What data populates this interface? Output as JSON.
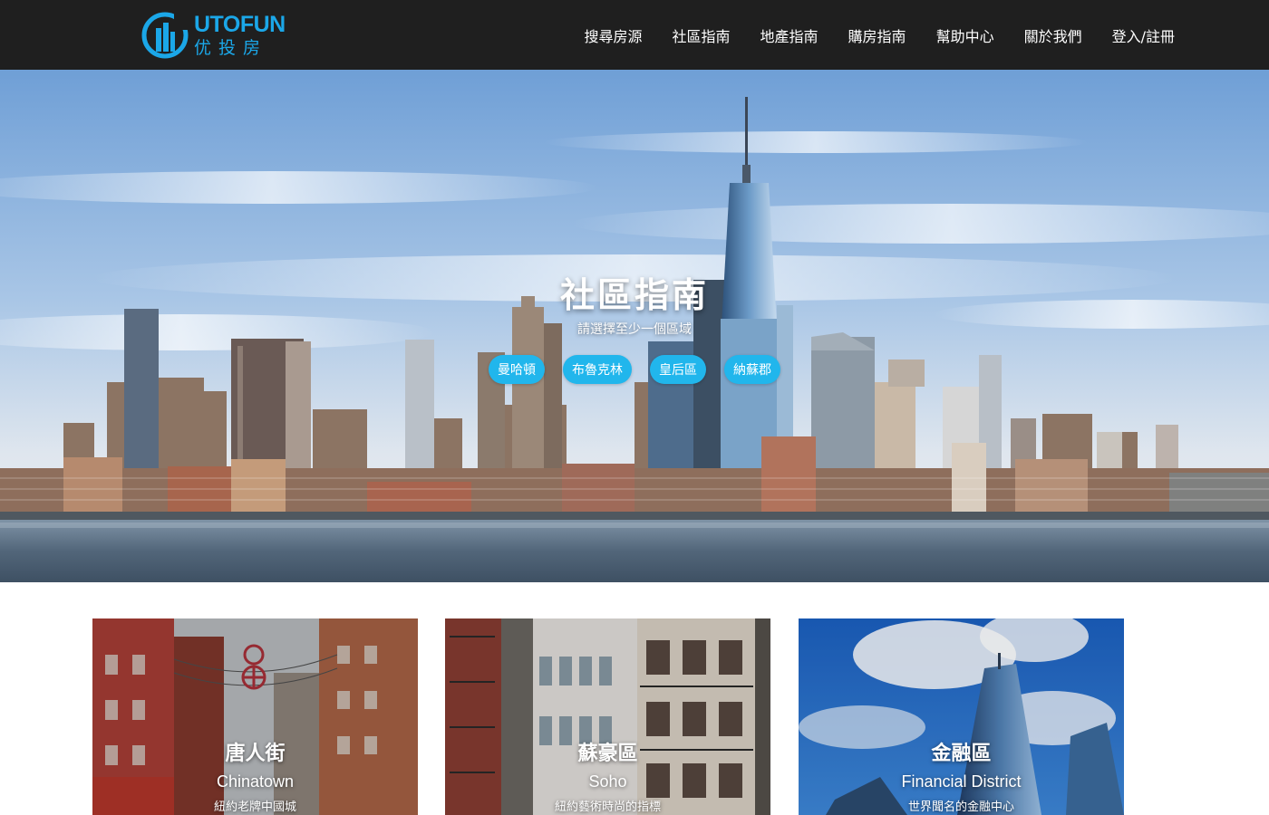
{
  "header": {
    "logo_en": "UTOFUN",
    "logo_cn": "优投房",
    "nav": [
      {
        "label": "搜尋房源"
      },
      {
        "label": "社區指南"
      },
      {
        "label": "地產指南"
      },
      {
        "label": "購房指南"
      },
      {
        "label": "幫助中心"
      },
      {
        "label": "關於我們"
      },
      {
        "label": "登入/註冊"
      }
    ]
  },
  "hero": {
    "title": "社區指南",
    "subtitle": "請選擇至少一個區域",
    "boroughs": [
      {
        "label": "曼哈頓"
      },
      {
        "label": "布魯克林"
      },
      {
        "label": "皇后區"
      },
      {
        "label": "納蘇郡"
      }
    ]
  },
  "neighborhoods": [
    {
      "title": "唐人街",
      "english": "Chinatown",
      "description": "紐約老牌中國城"
    },
    {
      "title": "蘇豪區",
      "english": "Soho",
      "description": "紐約藝術時尚的指標"
    },
    {
      "title": "金融區",
      "english": "Financial District",
      "description": "世界聞名的金融中心"
    }
  ],
  "colors": {
    "header_bg": "#1f1f1f",
    "brand_blue": "#1ba7e8",
    "pill_bg": "#21b6ec"
  }
}
